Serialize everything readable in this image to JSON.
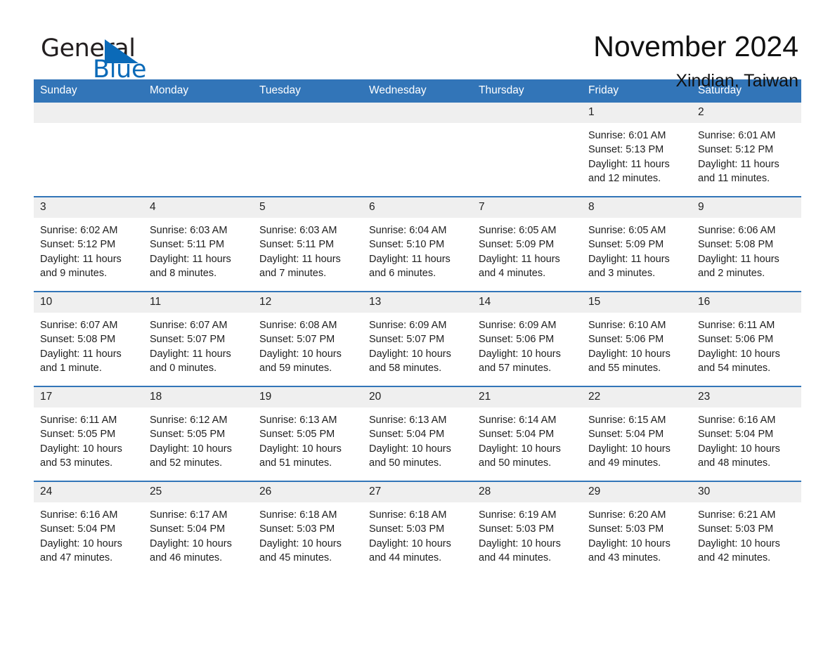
{
  "brand": {
    "word_one": "General",
    "word_two": "Blue",
    "triangle_color": "#0b6ab8",
    "text_color": "#231f20"
  },
  "header": {
    "month_title": "November 2024",
    "location": "Xindian, Taiwan"
  },
  "theme": {
    "header_blue": "#3275b8",
    "daynum_band": "#efefef",
    "separator_blue": "#3275b8"
  },
  "calendar": {
    "weekdays": [
      "Sunday",
      "Monday",
      "Tuesday",
      "Wednesday",
      "Thursday",
      "Friday",
      "Saturday"
    ],
    "weeks": [
      [
        {
          "day": "",
          "sunrise": "",
          "sunset": "",
          "daylight": ""
        },
        {
          "day": "",
          "sunrise": "",
          "sunset": "",
          "daylight": ""
        },
        {
          "day": "",
          "sunrise": "",
          "sunset": "",
          "daylight": ""
        },
        {
          "day": "",
          "sunrise": "",
          "sunset": "",
          "daylight": ""
        },
        {
          "day": "",
          "sunrise": "",
          "sunset": "",
          "daylight": ""
        },
        {
          "day": "1",
          "sunrise": "Sunrise: 6:01 AM",
          "sunset": "Sunset: 5:13 PM",
          "daylight": "Daylight: 11 hours and 12 minutes."
        },
        {
          "day": "2",
          "sunrise": "Sunrise: 6:01 AM",
          "sunset": "Sunset: 5:12 PM",
          "daylight": "Daylight: 11 hours and 11 minutes."
        }
      ],
      [
        {
          "day": "3",
          "sunrise": "Sunrise: 6:02 AM",
          "sunset": "Sunset: 5:12 PM",
          "daylight": "Daylight: 11 hours and 9 minutes."
        },
        {
          "day": "4",
          "sunrise": "Sunrise: 6:03 AM",
          "sunset": "Sunset: 5:11 PM",
          "daylight": "Daylight: 11 hours and 8 minutes."
        },
        {
          "day": "5",
          "sunrise": "Sunrise: 6:03 AM",
          "sunset": "Sunset: 5:11 PM",
          "daylight": "Daylight: 11 hours and 7 minutes."
        },
        {
          "day": "6",
          "sunrise": "Sunrise: 6:04 AM",
          "sunset": "Sunset: 5:10 PM",
          "daylight": "Daylight: 11 hours and 6 minutes."
        },
        {
          "day": "7",
          "sunrise": "Sunrise: 6:05 AM",
          "sunset": "Sunset: 5:09 PM",
          "daylight": "Daylight: 11 hours and 4 minutes."
        },
        {
          "day": "8",
          "sunrise": "Sunrise: 6:05 AM",
          "sunset": "Sunset: 5:09 PM",
          "daylight": "Daylight: 11 hours and 3 minutes."
        },
        {
          "day": "9",
          "sunrise": "Sunrise: 6:06 AM",
          "sunset": "Sunset: 5:08 PM",
          "daylight": "Daylight: 11 hours and 2 minutes."
        }
      ],
      [
        {
          "day": "10",
          "sunrise": "Sunrise: 6:07 AM",
          "sunset": "Sunset: 5:08 PM",
          "daylight": "Daylight: 11 hours and 1 minute."
        },
        {
          "day": "11",
          "sunrise": "Sunrise: 6:07 AM",
          "sunset": "Sunset: 5:07 PM",
          "daylight": "Daylight: 11 hours and 0 minutes."
        },
        {
          "day": "12",
          "sunrise": "Sunrise: 6:08 AM",
          "sunset": "Sunset: 5:07 PM",
          "daylight": "Daylight: 10 hours and 59 minutes."
        },
        {
          "day": "13",
          "sunrise": "Sunrise: 6:09 AM",
          "sunset": "Sunset: 5:07 PM",
          "daylight": "Daylight: 10 hours and 58 minutes."
        },
        {
          "day": "14",
          "sunrise": "Sunrise: 6:09 AM",
          "sunset": "Sunset: 5:06 PM",
          "daylight": "Daylight: 10 hours and 57 minutes."
        },
        {
          "day": "15",
          "sunrise": "Sunrise: 6:10 AM",
          "sunset": "Sunset: 5:06 PM",
          "daylight": "Daylight: 10 hours and 55 minutes."
        },
        {
          "day": "16",
          "sunrise": "Sunrise: 6:11 AM",
          "sunset": "Sunset: 5:06 PM",
          "daylight": "Daylight: 10 hours and 54 minutes."
        }
      ],
      [
        {
          "day": "17",
          "sunrise": "Sunrise: 6:11 AM",
          "sunset": "Sunset: 5:05 PM",
          "daylight": "Daylight: 10 hours and 53 minutes."
        },
        {
          "day": "18",
          "sunrise": "Sunrise: 6:12 AM",
          "sunset": "Sunset: 5:05 PM",
          "daylight": "Daylight: 10 hours and 52 minutes."
        },
        {
          "day": "19",
          "sunrise": "Sunrise: 6:13 AM",
          "sunset": "Sunset: 5:05 PM",
          "daylight": "Daylight: 10 hours and 51 minutes."
        },
        {
          "day": "20",
          "sunrise": "Sunrise: 6:13 AM",
          "sunset": "Sunset: 5:04 PM",
          "daylight": "Daylight: 10 hours and 50 minutes."
        },
        {
          "day": "21",
          "sunrise": "Sunrise: 6:14 AM",
          "sunset": "Sunset: 5:04 PM",
          "daylight": "Daylight: 10 hours and 50 minutes."
        },
        {
          "day": "22",
          "sunrise": "Sunrise: 6:15 AM",
          "sunset": "Sunset: 5:04 PM",
          "daylight": "Daylight: 10 hours and 49 minutes."
        },
        {
          "day": "23",
          "sunrise": "Sunrise: 6:16 AM",
          "sunset": "Sunset: 5:04 PM",
          "daylight": "Daylight: 10 hours and 48 minutes."
        }
      ],
      [
        {
          "day": "24",
          "sunrise": "Sunrise: 6:16 AM",
          "sunset": "Sunset: 5:04 PM",
          "daylight": "Daylight: 10 hours and 47 minutes."
        },
        {
          "day": "25",
          "sunrise": "Sunrise: 6:17 AM",
          "sunset": "Sunset: 5:04 PM",
          "daylight": "Daylight: 10 hours and 46 minutes."
        },
        {
          "day": "26",
          "sunrise": "Sunrise: 6:18 AM",
          "sunset": "Sunset: 5:03 PM",
          "daylight": "Daylight: 10 hours and 45 minutes."
        },
        {
          "day": "27",
          "sunrise": "Sunrise: 6:18 AM",
          "sunset": "Sunset: 5:03 PM",
          "daylight": "Daylight: 10 hours and 44 minutes."
        },
        {
          "day": "28",
          "sunrise": "Sunrise: 6:19 AM",
          "sunset": "Sunset: 5:03 PM",
          "daylight": "Daylight: 10 hours and 44 minutes."
        },
        {
          "day": "29",
          "sunrise": "Sunrise: 6:20 AM",
          "sunset": "Sunset: 5:03 PM",
          "daylight": "Daylight: 10 hours and 43 minutes."
        },
        {
          "day": "30",
          "sunrise": "Sunrise: 6:21 AM",
          "sunset": "Sunset: 5:03 PM",
          "daylight": "Daylight: 10 hours and 42 minutes."
        }
      ]
    ]
  }
}
